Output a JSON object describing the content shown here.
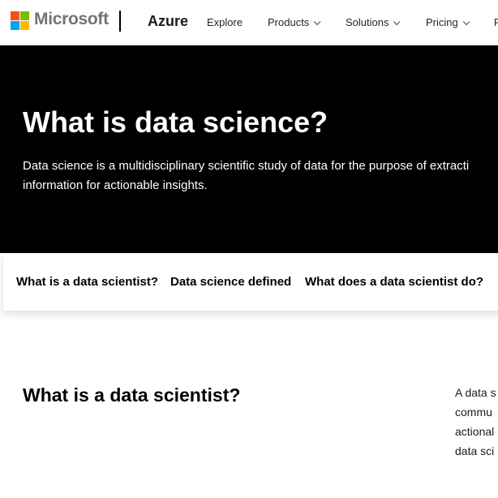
{
  "header": {
    "brand": "Microsoft",
    "product": "Azure",
    "nav": [
      {
        "label": "Explore",
        "has_dropdown": false
      },
      {
        "label": "Products",
        "has_dropdown": true
      },
      {
        "label": "Solutions",
        "has_dropdown": true
      },
      {
        "label": "Pricing",
        "has_dropdown": true
      },
      {
        "label": "P",
        "has_dropdown": false
      }
    ]
  },
  "hero": {
    "title": "What is data science?",
    "description_line1": "Data science is a multidisciplinary scientific study of data for the purpose of extracti",
    "description_line2": "information for actionable insights."
  },
  "tabs": [
    {
      "label": "What is a data scientist?"
    },
    {
      "label": "Data science defined"
    },
    {
      "label": "What does a data scientist do?"
    }
  ],
  "content": {
    "section_title": "What is a data scientist?",
    "right_lines": [
      "A data s",
      "commu",
      "actional",
      "data sci"
    ]
  },
  "colors": {
    "logo_red": "#f25022",
    "logo_green": "#7fba00",
    "logo_blue": "#00a4ef",
    "logo_yellow": "#ffb900",
    "hero_background": "#000000"
  }
}
